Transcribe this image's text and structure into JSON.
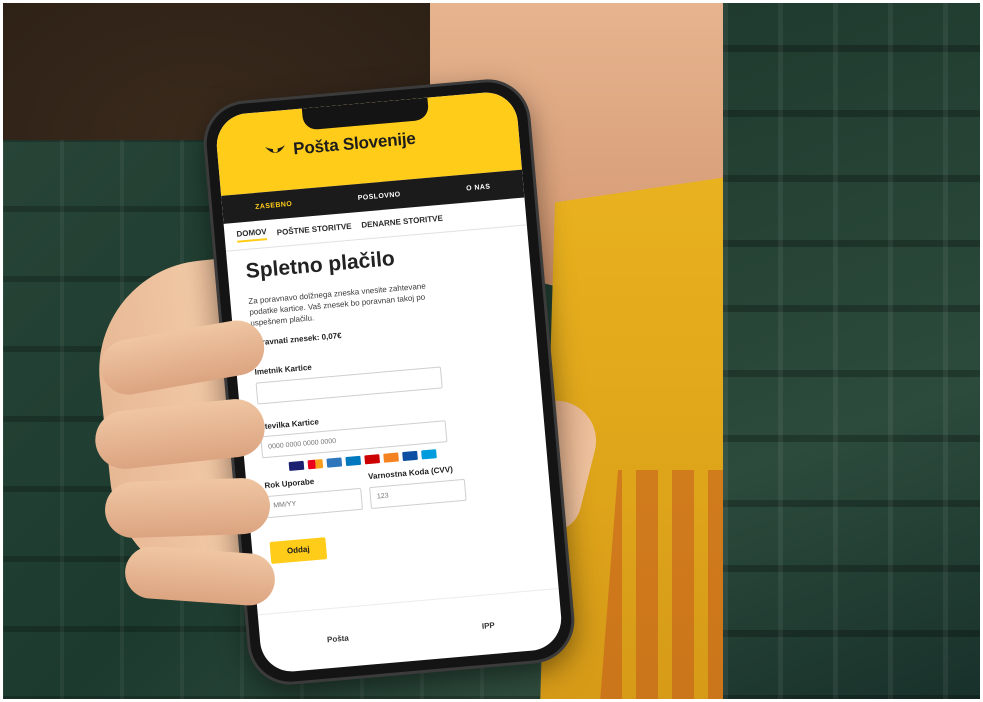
{
  "scene": {
    "colors": {
      "accent": "#ffcc1a",
      "shirt": "#24443a",
      "tshirt": "#e4aa1c"
    }
  },
  "app": {
    "brand": "Pošta Slovenije",
    "nav_primary": [
      "ZASEBNO",
      "POSLOVNO",
      "O NAS"
    ],
    "nav_secondary": [
      "DOMOV",
      "POŠTNE STORITVE",
      "DENARNE STORITVE"
    ],
    "page_title": "Spletno plačilo",
    "description": "Za poravnavo dolžnega zneska vnesite zahtevane podatke kartice. Vaš znesek bo poravnan takoj po uspešnem plačilu.",
    "amount": "poravnati znesek: 0,07€",
    "fields": {
      "card_name_label": "Imetnik Kartice",
      "card_name_placeholder": "",
      "card_number_label": "Številka Kartice",
      "card_number_placeholder": "0000 0000 0000 0000",
      "expiry_label": "Rok Uporabe",
      "expiry_placeholder": "MM/YY",
      "cvv_label": "Varnostna Koda (CVV)",
      "cvv_placeholder": "123"
    },
    "card_icons": [
      "visa-icon",
      "mastercard-icon",
      "amex-icon",
      "diners-icon",
      "maestro-icon",
      "discover-icon",
      "jcb-icon",
      "paypal-icon"
    ],
    "pay_button": "Oddaj",
    "footer": [
      "Pošta",
      "IPP"
    ]
  }
}
